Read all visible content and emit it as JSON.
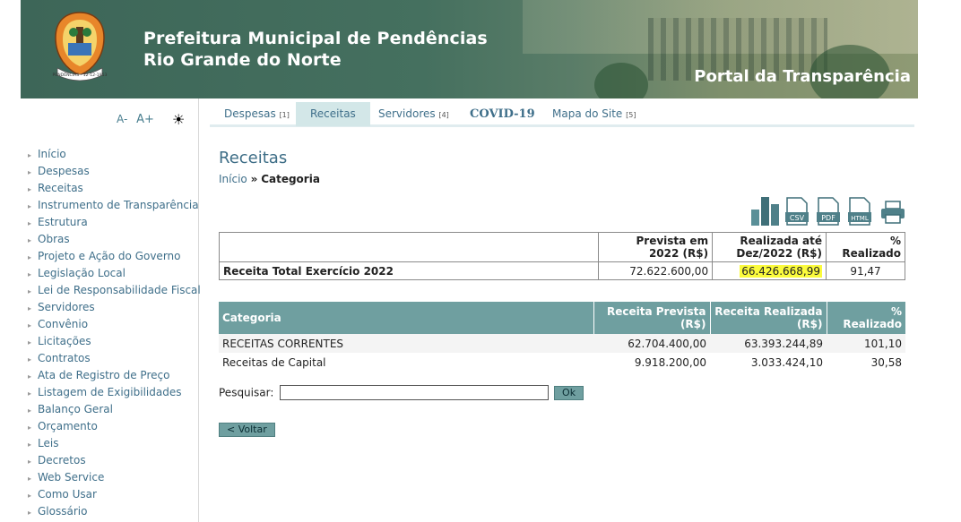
{
  "header": {
    "title_line1": "Prefeitura Municipal de Pendências",
    "title_line2": "Rio Grande do Norte",
    "portal": "Portal da Transparência",
    "logo_text": "PENDÊNCIAS - 12-12-1953"
  },
  "font_controls": {
    "decrease": "A-",
    "increase": "A+",
    "contrast_icon": "sun-icon"
  },
  "sidebar": {
    "items": [
      "Início",
      "Despesas",
      "Receitas",
      "Instrumento de Transparência",
      "Estrutura",
      "Obras",
      "Projeto e Ação do Governo",
      "Legislação Local",
      "Lei de Responsabilidade Fiscal",
      "Servidores",
      "Convênio",
      "Licitações",
      "Contratos",
      "Ata de Registro de Preço",
      "Listagem de Exigibilidades",
      "Balanço Geral",
      "Orçamento",
      "Leis",
      "Decretos",
      "Web Service",
      "Como Usar",
      "Glossário"
    ]
  },
  "tabs": [
    {
      "label": "Despesas",
      "count": "[1]"
    },
    {
      "label": "Receitas",
      "count": ""
    },
    {
      "label": "Servidores",
      "count": "[4]"
    },
    {
      "label": "COVID-19",
      "count": ""
    },
    {
      "label": "Mapa do Site",
      "count": "[5]"
    }
  ],
  "page": {
    "title": "Receitas",
    "breadcrumb_home": "Início",
    "breadcrumb_sep": "»",
    "breadcrumb_current": "Categoria"
  },
  "exports": {
    "csv": "CSV",
    "pdf": "PDF",
    "html": "HTML"
  },
  "summary": {
    "col_prevista": "Prevista em 2022 (R$)",
    "col_realizada": "Realizada até Dez/2022 (R$)",
    "col_pct": "% Realizado",
    "row_label": "Receita Total Exercício 2022",
    "prevista": "72.622.600,00",
    "realizada": "66.426.668,99",
    "pct": "91,47"
  },
  "category_table": {
    "headers": [
      "Categoria",
      "Receita Prevista (R$)",
      "Receita Realizada (R$)",
      "% Realizado"
    ],
    "rows": [
      [
        "RECEITAS CORRENTES",
        "62.704.400,00",
        "63.393.244,89",
        "101,10"
      ],
      [
        "Receitas de Capital",
        "9.918.200,00",
        "3.033.424,10",
        "30,58"
      ]
    ]
  },
  "search": {
    "label": "Pesquisar:",
    "value": "",
    "button": "Ok"
  },
  "back_button": "< Voltar"
}
